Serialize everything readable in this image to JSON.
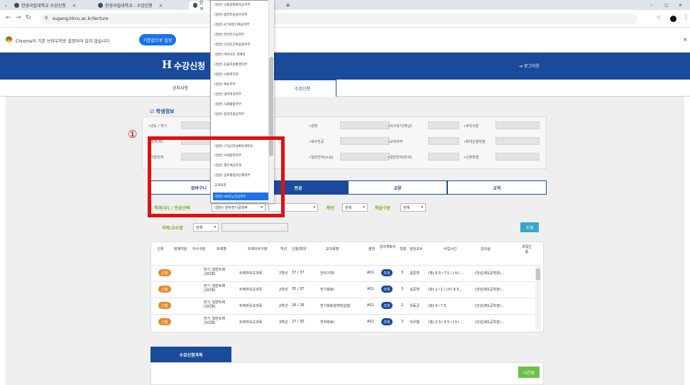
{
  "browser": {
    "tabs": [
      {
        "label": "한경국립대학교 수강신청"
      },
      {
        "label": "한경국립대학교 - 수강신청"
      },
      {
        "label": "한경"
      }
    ],
    "new_tab": "+",
    "url": "sugang.hknu.ac.kr/lecture",
    "infobar_text": "Chrome이 기본 브라우저로 설정되어 있지 않습니다",
    "infobar_button": "기본값으로 설정",
    "window_controls": [
      "–",
      "▢",
      "✕"
    ]
  },
  "site": {
    "logo": "H",
    "title": "수강신청",
    "logout": "로그아웃",
    "nav": {
      "notice": "공지사항",
      "register": "수강신청"
    }
  },
  "student_info": {
    "title": "학생정보",
    "fields": [
      {
        "label": "•년도 / 학기"
      },
      {
        "label": "•성명"
      },
      {
        "label": "•이수학기(학년)"
      },
      {
        "label": "•주야구분"
      },
      {
        "label": "•학과(부)"
      },
      {
        "label": "•복수전공"
      },
      {
        "label": "•교직여부"
      },
      {
        "label": "•최대신청학점"
      },
      {
        "label": "•기본잔여"
      },
      {
        "label": "•일반잔여(소속)"
      },
      {
        "label": "•일반잔여(타과)"
      },
      {
        "label": "•신청학점"
      }
    ]
  },
  "main_tabs": [
    {
      "label": "장바구니",
      "active": false
    },
    {
      "label": "전공",
      "active": true
    },
    {
      "label": "교양",
      "active": false
    },
    {
      "label": "교직",
      "active": false
    }
  ],
  "filters": {
    "dept_label": "학과(부) / 전공선택",
    "dept_value": "(일반) 전자전기공학부",
    "year_label": "학년",
    "year_value": "전체",
    "type_label": "학습구분",
    "type_value": "전체",
    "prof_label": "과목/교수명",
    "prof_value": "전체",
    "search_button": "조회"
  },
  "dropdown": {
    "items": [
      "(일반) 식품생명화학공학부",
      "(일반) 컴퓨터응용수학부",
      "(일반) ICT로봇기계공학부",
      "(일반) 전자전기공학부",
      "(일반) 디자인건축융합학부",
      "(일반) 바이오인 경제학",
      "(일반) 동물자원환경학부",
      "(일반) 사회복지학",
      "(일반) 체육학부",
      "(일반) 영어학과학부",
      "(일반) 사회통합학부",
      "(일반) 창의지원공학부",
      "",
      "(일반) (가상)한국체육대학교",
      "(일반) 아세정학학부",
      "(일반) 평도체공학과",
      "(일반) 글로벌창의인재학부",
      "교과학과",
      "(일반) HK지능전공학부"
    ],
    "selected_index": 18
  },
  "course_table": {
    "headers": [
      "신청",
      "장애지원",
      "이수구분",
      "트랙명",
      "트랙이수구분",
      "학년",
      "신청/최대",
      "교과목명",
      "분반",
      "강의계획서",
      "학점",
      "담당교수",
      "수업시간",
      "강의실",
      "과목인증"
    ],
    "apply_label": "신청",
    "plan_label": "조회",
    "rows": [
      {
        "track": "전기_일반트랙(2018)",
        "track_type": "트랙자유교과목",
        "year": "2학년",
        "quota": "37 / 37",
        "course": "전자기학I",
        "section": "A01",
        "credit": "3",
        "professor": "김준혁",
        "time": "(월) 6.5~7.5 / (수) ...",
        "room": "(안성)제1공학관(..."
      },
      {
        "track": "전기_일반트랙(2018)",
        "track_type": "트랙자유교과목",
        "year": "2학년",
        "quota": "35 / 37",
        "course": "전기회로I",
        "section": "A01",
        "credit": "3",
        "professor": "김준혁",
        "time": "(화) 1~2 / (수) 6.5...",
        "room": "(안성)제1공학관(..."
      },
      {
        "track": "전기_일반트랙(2018)",
        "track_type": "트랙자유교과목",
        "year": "2학년",
        "quota": "26 / 26",
        "course": "전기회로설계및실험I",
        "section": "A01",
        "credit": "2",
        "professor": "유동균",
        "time": "(화) 5~7.5",
        "room": "(안성)제1공학관(..."
      },
      {
        "track": "전기_일반트랙(2018)",
        "track_type": "트랙자유교과목",
        "year": "3학년",
        "quota": "27 / 30",
        "course": "전자회로I",
        "section": "A01",
        "credit": "3",
        "professor": "이우열",
        "time": "(월) 2.5~3.5 / (수) ...",
        "room": "(안성)제1공학관(..."
      }
    ]
  },
  "registered": {
    "title": "수강신청과목",
    "timetable_button": "시간표"
  },
  "annotation": {
    "marker": "①"
  },
  "colors": {
    "brand": "#1a4b9b",
    "accent_green": "#7cac1a",
    "apply_orange": "#e88a2a",
    "annotation_red": "#e01010"
  }
}
